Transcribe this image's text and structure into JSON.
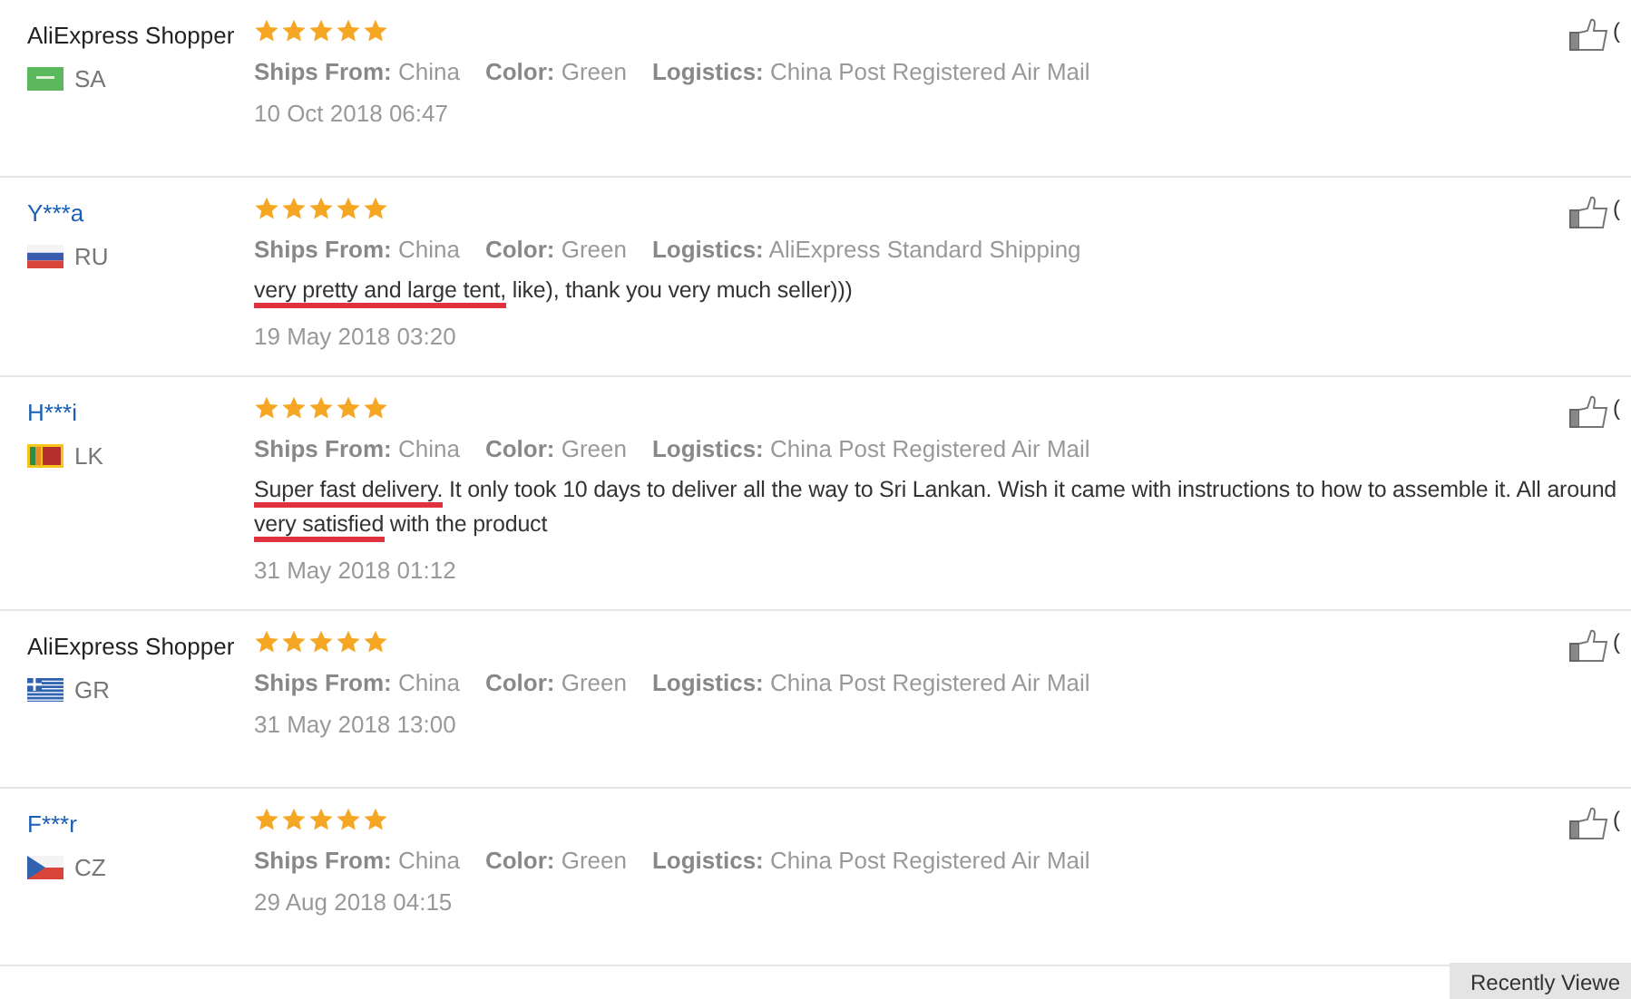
{
  "reviews": [
    {
      "name": "AliExpress Shopper",
      "linked": false,
      "flag": {
        "kind": "sa"
      },
      "country": "SA",
      "stars": 5,
      "specs": [
        {
          "label": "Ships From:",
          "value": "China"
        },
        {
          "label": "Color:",
          "value": "Green"
        },
        {
          "label": "Logistics:",
          "value": "China Post Registered Air Mail"
        }
      ],
      "date": "10 Oct 2018 06:47",
      "likes": "("
    },
    {
      "name": "Y***a",
      "linked": true,
      "flag": {
        "kind": "ru"
      },
      "country": "RU",
      "stars": 5,
      "specs": [
        {
          "label": "Ships From:",
          "value": "China"
        },
        {
          "label": "Color:",
          "value": "Green"
        },
        {
          "label": "Logistics:",
          "value": "AliExpress Standard Shipping"
        }
      ],
      "comment": [
        {
          "text": "very pretty and large tent,",
          "underlined": true
        },
        {
          "text": " like), thank you very much seller)))",
          "underlined": false
        }
      ],
      "date": "19 May 2018 03:20",
      "likes": "("
    },
    {
      "name": "H***i",
      "linked": true,
      "flag": {
        "kind": "lk"
      },
      "country": "LK",
      "stars": 5,
      "specs": [
        {
          "label": "Ships From:",
          "value": "China"
        },
        {
          "label": "Color:",
          "value": "Green"
        },
        {
          "label": "Logistics:",
          "value": "China Post Registered Air Mail"
        }
      ],
      "comment": [
        {
          "text": "Super fast delivery.",
          "underlined": true
        },
        {
          "text": " It only took 10 days to deliver all the way to Sri Lankan. Wish it came with instructions to how to assemble it. All around ",
          "underlined": false
        },
        {
          "text": "very satisfied",
          "underlined": true
        },
        {
          "text": " with the product",
          "underlined": false
        }
      ],
      "date": "31 May 2018 01:12",
      "likes": "("
    },
    {
      "name": "AliExpress Shopper",
      "linked": false,
      "flag": {
        "kind": "gr"
      },
      "country": "GR",
      "stars": 5,
      "specs": [
        {
          "label": "Ships From:",
          "value": "China"
        },
        {
          "label": "Color:",
          "value": "Green"
        },
        {
          "label": "Logistics:",
          "value": "China Post Registered Air Mail"
        }
      ],
      "date": "31 May 2018 13:00",
      "likes": "("
    },
    {
      "name": "F***r",
      "linked": true,
      "flag": {
        "kind": "cz"
      },
      "country": "CZ",
      "stars": 5,
      "specs": [
        {
          "label": "Ships From:",
          "value": "China"
        },
        {
          "label": "Color:",
          "value": "Green"
        },
        {
          "label": "Logistics:",
          "value": "China Post Registered Air Mail"
        }
      ],
      "date": "29 Aug 2018 04:15",
      "likes": "("
    }
  ],
  "recent_tab": {
    "label": "Recently Viewe"
  }
}
